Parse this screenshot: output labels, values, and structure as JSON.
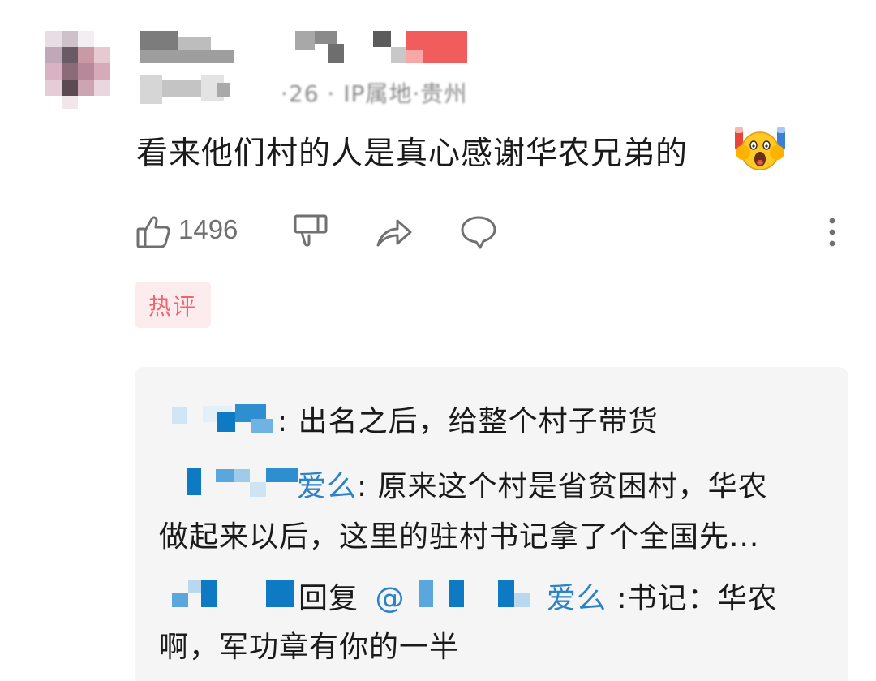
{
  "comment": {
    "meta_text": "·26 · IP属地·贵州",
    "text": "看来他们村的人是真心感谢华农兄弟的",
    "emoji": "scream-emoji",
    "like_count": "1496",
    "badge": "热评"
  },
  "replies": [
    {
      "user_suffix": "",
      "separator": ":",
      "text": " 出名之后，给整个村子带货"
    },
    {
      "user_suffix": "爱么",
      "separator": ":",
      "text_line1": " 原来这个村是省贫困村，华农",
      "text_line2": "做起来以后，这里的驻村书记拿了个全国先..."
    },
    {
      "reply_label": "回复",
      "at": "@",
      "target_suffix": "爱么",
      "separator": " :",
      "text_line1": "书记：华农",
      "text_line2": "啊，军功章有你的一半"
    }
  ],
  "colors": {
    "link_blue": "#2d82c7",
    "badge_bg": "#fdecee",
    "badge_text": "#f0626f",
    "reply_bg": "#f5f5f5",
    "icon_gray": "#6f6f6f"
  },
  "icons": [
    "thumbs-up-icon",
    "thumbs-down-icon",
    "share-icon",
    "reply-icon",
    "more-vertical-icon"
  ]
}
